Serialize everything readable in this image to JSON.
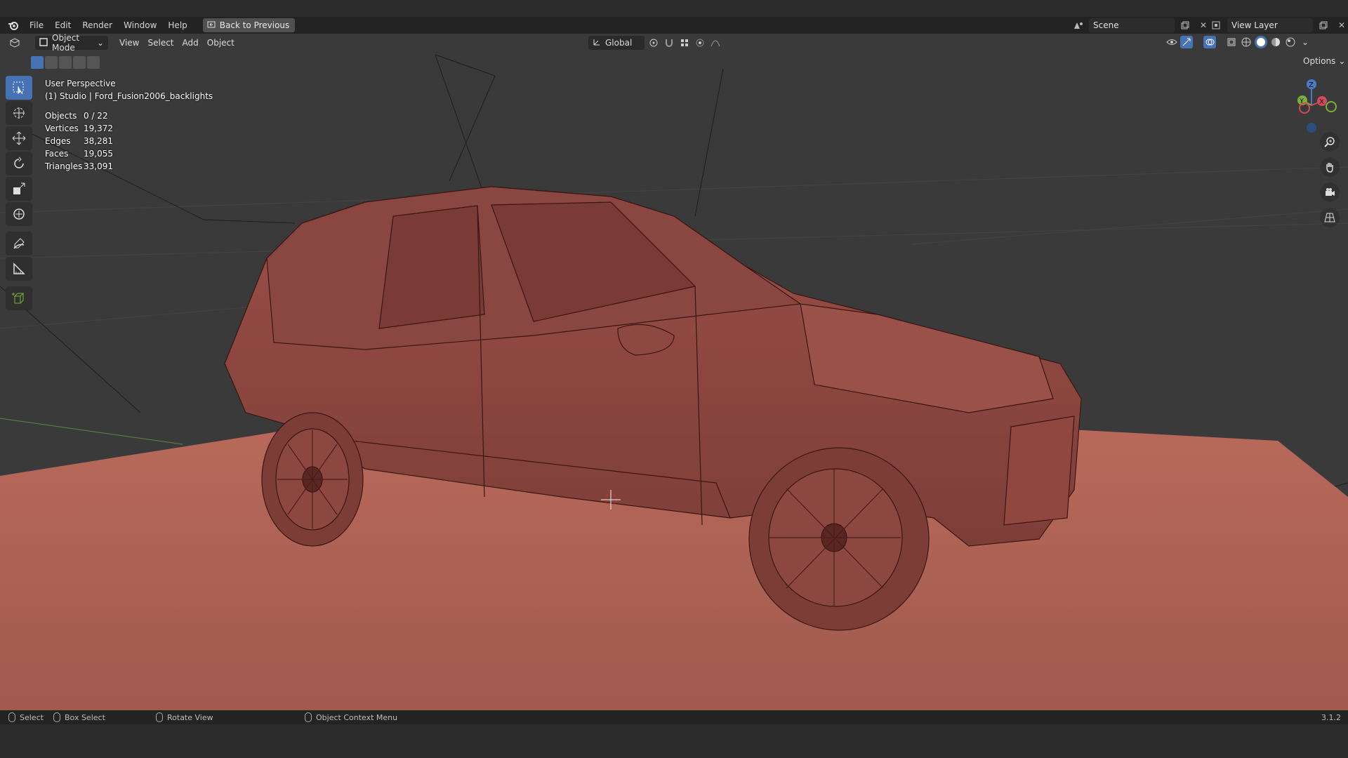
{
  "menubar": {
    "items": [
      "File",
      "Edit",
      "Render",
      "Window",
      "Help"
    ],
    "back_button": "Back to Previous",
    "scene": "Scene",
    "view_layer": "View Layer"
  },
  "viewport_header": {
    "mode": "Object Mode",
    "menus": [
      "View",
      "Select",
      "Add",
      "Object"
    ],
    "transform_orientation": "Global",
    "options": "Options"
  },
  "overlay": {
    "perspective": "User Perspective",
    "collection_object": "(1) Studio | Ford_Fusion2006_backlights",
    "stats": [
      {
        "label": "Objects",
        "value": "0 / 22"
      },
      {
        "label": "Vertices",
        "value": "19,372"
      },
      {
        "label": "Edges",
        "value": "38,281"
      },
      {
        "label": "Faces",
        "value": "19,055"
      },
      {
        "label": "Triangles",
        "value": "33,091"
      }
    ]
  },
  "gizmo": {
    "z": "Z",
    "y": "Y",
    "x": "X"
  },
  "toolbar": {
    "tools": [
      "select-box-tool",
      "cursor-tool",
      "move-tool",
      "rotate-tool",
      "scale-tool",
      "transform-tool",
      "annotate-tool",
      "measure-tool",
      "add-cube-tool"
    ]
  },
  "statusbar": {
    "select": "Select",
    "box_select": "Box Select",
    "rotate_view": "Rotate View",
    "context_menu": "Object Context Menu",
    "version": "3.1.2"
  },
  "colors": {
    "accent": "#4772b3",
    "model": "#a0574f",
    "floor": "#b56a5c",
    "viewport_bg": "#3a3a3a"
  }
}
